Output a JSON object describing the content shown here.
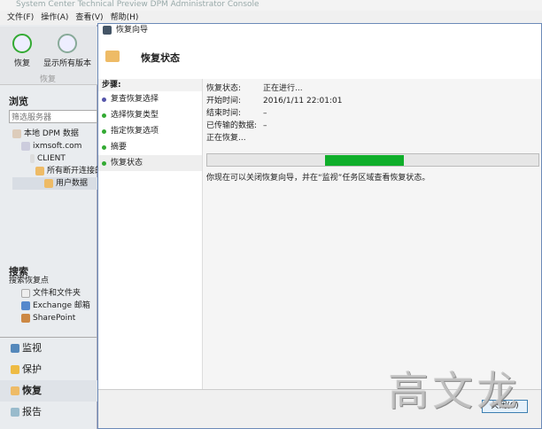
{
  "window": {
    "title": "System Center Technical Preview DPM Administrator Console"
  },
  "menu": [
    "文件(F)",
    "操作(A)",
    "查看(V)",
    "帮助(H)"
  ],
  "ribbon": {
    "buttons": [
      "恢复",
      "显示所有版本"
    ],
    "group": "恢复"
  },
  "browse": {
    "title": "浏览",
    "filter_placeholder": "筛选服务器",
    "tree": [
      "本地 DPM 数据",
      "ixmsoft.com",
      "CLIENT",
      "所有断开连接的",
      "用户数据"
    ]
  },
  "search": {
    "title": "搜索",
    "root": "搜索恢复点",
    "items": [
      "文件和文件夹",
      "Exchange 邮箱",
      "SharePoint"
    ]
  },
  "nav": [
    "监视",
    "保护",
    "恢复",
    "报告"
  ],
  "dialog": {
    "title": "恢复向导",
    "header": "恢复状态",
    "steps_title": "步骤:",
    "steps": [
      "复查恢复选择",
      "选择恢复类型",
      "指定恢复选项",
      "摘要",
      "恢复状态"
    ],
    "fields": [
      {
        "label": "恢复状态:",
        "value": "正在进行..."
      },
      {
        "label": "开始时间:",
        "value": "2016/1/11 22:01:01"
      },
      {
        "label": "结束时间:",
        "value": "–"
      },
      {
        "label": "已传输的数据:",
        "value": "–"
      }
    ],
    "progress_label": "正在恢复...",
    "progress_note": "你现在可以关闭恢复向导，并在“监视”任务区域查看恢复状态。",
    "close_button": "关闭(C)"
  },
  "watermark": "高文龙",
  "colors": {
    "progress": "#0fae2a",
    "accent": "#3c7fb1"
  }
}
